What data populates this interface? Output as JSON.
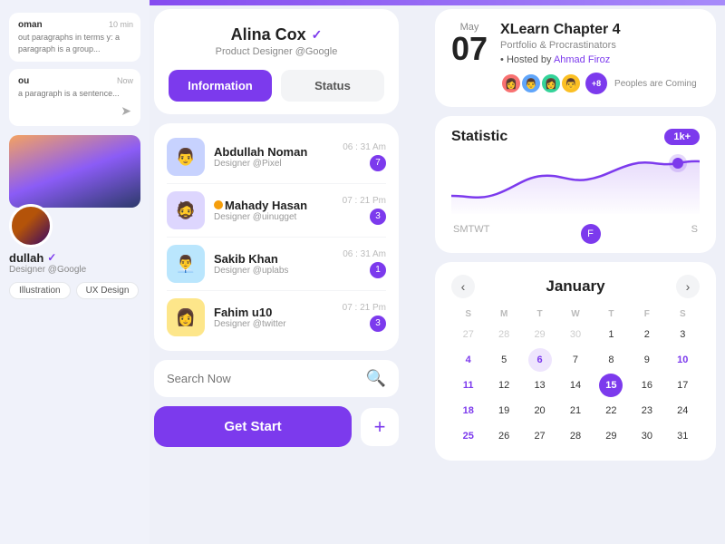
{
  "topbar": {},
  "left": {
    "chat1": {
      "sender": "oman",
      "time": "10 min",
      "text": "out paragraphs in terms\ny: a paragraph is a\ngroup..."
    },
    "chat2": {
      "sender": "ou",
      "time": "Now",
      "text": "a paragraph is a sentence..."
    },
    "profile": {
      "name": "dullah",
      "verified": "✓",
      "title": "Designer @Google",
      "tags": [
        "Illustration",
        "UX Design"
      ]
    }
  },
  "center": {
    "profile": {
      "name": "Alina Cox",
      "verified": "✓",
      "subtitle": "Product Designer @Google"
    },
    "tabs": {
      "information": "Information",
      "status": "Status"
    },
    "contacts": [
      {
        "name": "Abdullah Noman",
        "role": "Designer @Pixel",
        "time": "06 : 31 Am",
        "badge": "7",
        "avatar_color": "#6366f1",
        "emoji": "👨"
      },
      {
        "name": "Mahady Hasan",
        "role": "Designer @uinugget",
        "time": "07 : 21 Pm",
        "badge": "3",
        "avatar_color": "#8b5cf6",
        "emoji": "🧔",
        "has_nugget": true
      },
      {
        "name": "Sakib Khan",
        "role": "Designer @uplabs",
        "time": "06 : 31 Am",
        "badge": "1",
        "avatar_color": "#0ea5e9",
        "emoji": "👨‍💼"
      },
      {
        "name": "Fahim u10",
        "role": "Designer @twitter",
        "time": "07 : 21 Pm",
        "badge": "3",
        "avatar_color": "#f59e0b",
        "emoji": "👩"
      }
    ],
    "search": {
      "placeholder": "Search Now"
    },
    "actions": {
      "get_start": "Get Start",
      "plus": "+"
    }
  },
  "right": {
    "event": {
      "month": "May",
      "day": "07",
      "title": "XLearn Chapter 4",
      "subtitle": "Portfolio & Procrastinators",
      "host_prefix": "• Hosted by ",
      "host_name": "Ahmad Firoz",
      "attendees_extra": "+8",
      "attendees_label": "Peoples are Coming"
    },
    "statistic": {
      "title": "Statistic",
      "badge": "1k+",
      "days": [
        "S",
        "M",
        "T",
        "W",
        "T",
        "F",
        "S"
      ],
      "active_day": "F"
    },
    "calendar": {
      "title": "January",
      "day_labels": [
        "S",
        "M",
        "T",
        "W",
        "T",
        "F",
        "S"
      ],
      "weeks": [
        [
          "27",
          "28",
          "29",
          "30",
          "1",
          "2",
          "3"
        ],
        [
          "4",
          "5",
          "6",
          "7",
          "8",
          "9",
          "10"
        ],
        [
          "11",
          "12",
          "13",
          "14",
          "15",
          "16",
          "17"
        ],
        [
          "18",
          "19",
          "20",
          "21",
          "22",
          "23",
          "24"
        ],
        [
          "25",
          "26",
          "27",
          "28",
          "29",
          "30",
          "31"
        ]
      ],
      "today": "15",
      "highlight": "6",
      "other_days": [
        "27",
        "28",
        "29",
        "30",
        "27",
        "28",
        "29",
        "30",
        "31"
      ],
      "week1_others": [
        0,
        1,
        2,
        3
      ],
      "sunday_col": 0
    }
  }
}
